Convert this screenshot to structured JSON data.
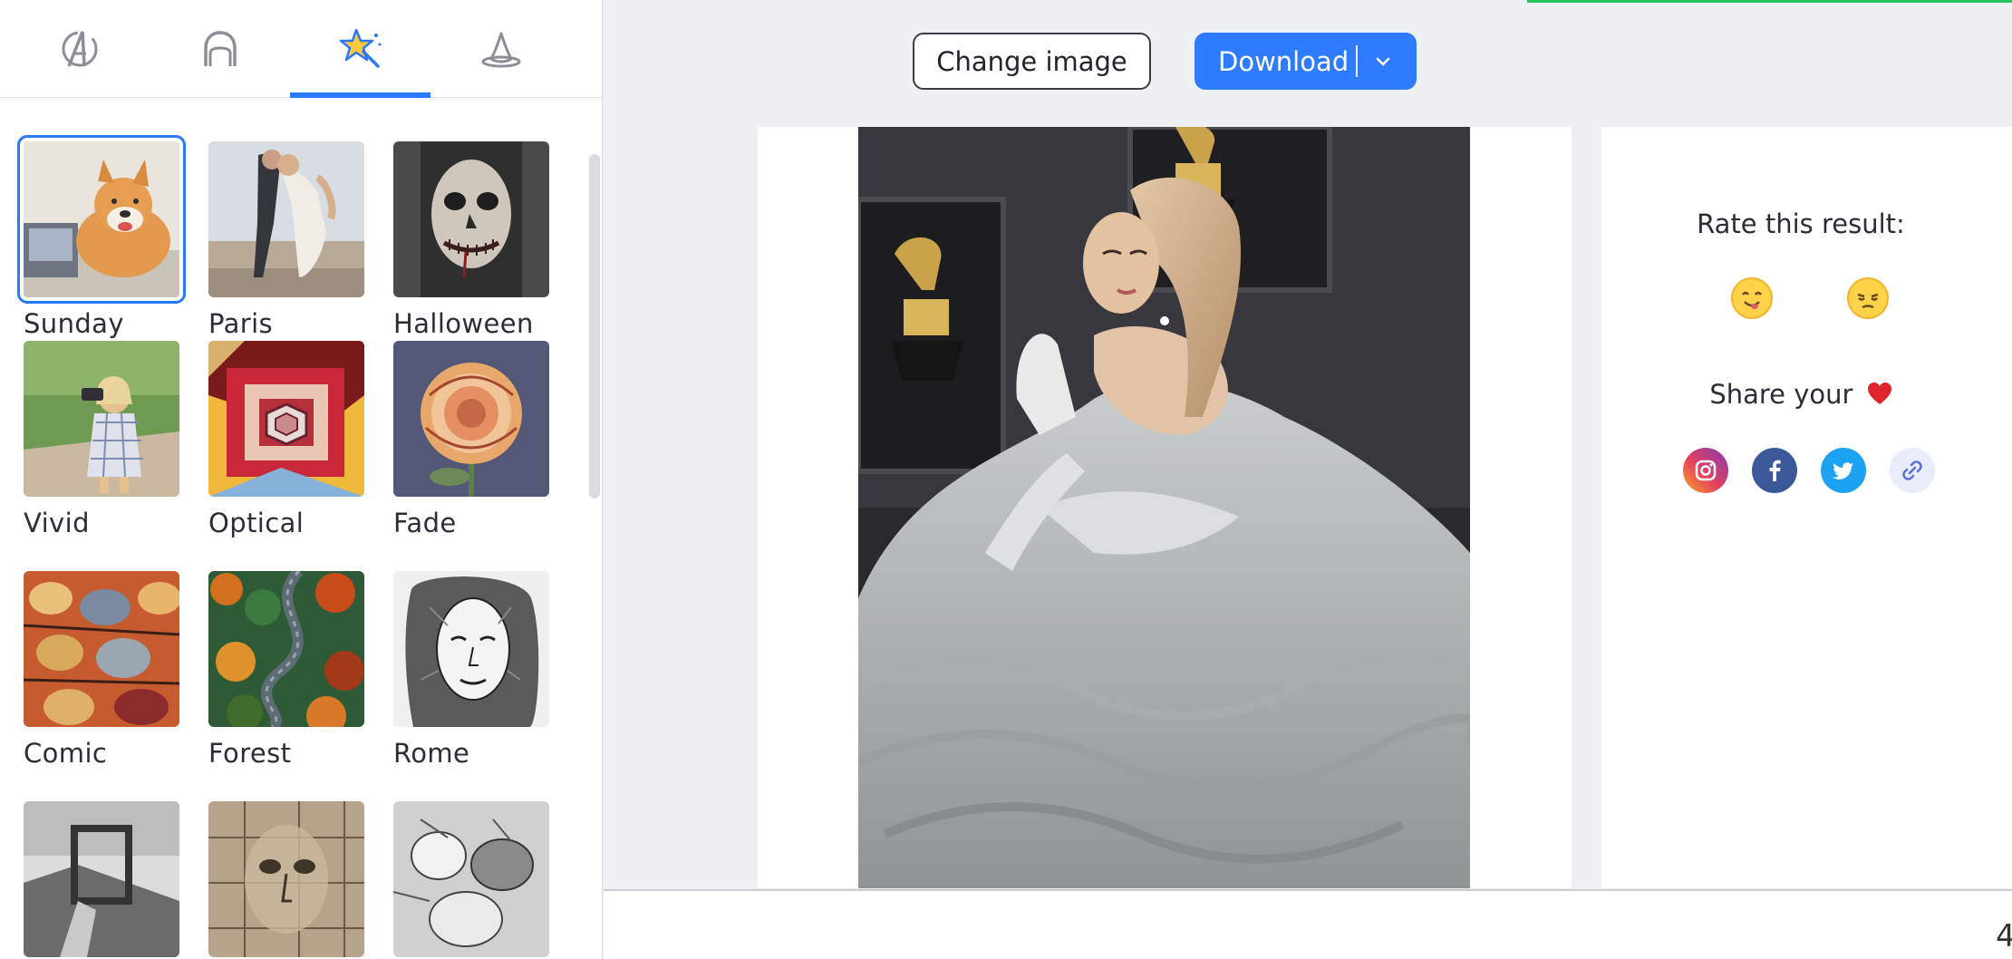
{
  "tabs": [
    {
      "name": "avengers-icon",
      "active": false
    },
    {
      "name": "helmet-icon",
      "active": false
    },
    {
      "name": "magic-star-icon",
      "active": true
    },
    {
      "name": "witch-hat-icon",
      "active": false
    }
  ],
  "effects": [
    {
      "label": "Sunday",
      "selected": true
    },
    {
      "label": "Paris"
    },
    {
      "label": "Halloween"
    },
    {
      "label": "Vivid"
    },
    {
      "label": "Optical"
    },
    {
      "label": "Fade"
    },
    {
      "label": "Comic"
    },
    {
      "label": "Forest"
    },
    {
      "label": "Rome"
    },
    {
      "label": ""
    },
    {
      "label": ""
    },
    {
      "label": ""
    }
  ],
  "toolbar": {
    "change_image_label": "Change image",
    "download_label": "Download"
  },
  "feedback": {
    "rate_title": "Rate this result:",
    "share_title": "Share your"
  },
  "icons": {
    "heart": "heart-icon",
    "like_emoji": "smiling-face-icon",
    "dislike_emoji": "pensive-face-icon",
    "social": [
      "instagram-icon",
      "facebook-icon",
      "twitter-icon",
      "copy-link-icon"
    ]
  },
  "colors": {
    "accent": "#2f7bff",
    "progress": "#22c55e",
    "facebook": "#3b5998",
    "twitter": "#1da1f2"
  },
  "bottom": {
    "glyph": "4"
  }
}
